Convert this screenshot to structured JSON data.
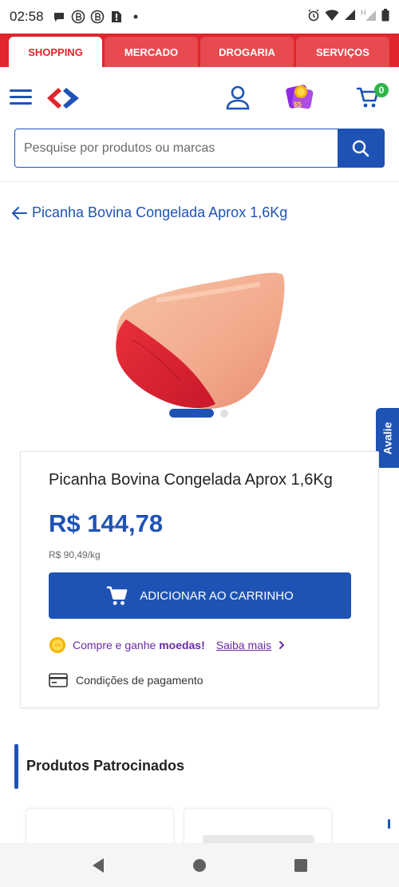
{
  "status_bar": {
    "time": "02:58"
  },
  "tabs": [
    {
      "label": "SHOPPING",
      "active": true
    },
    {
      "label": "MERCADO",
      "active": false
    },
    {
      "label": "DROGARIA",
      "active": false
    },
    {
      "label": "SERVIÇOS",
      "active": false
    }
  ],
  "header": {
    "cart_count": "0"
  },
  "search": {
    "placeholder": "Pesquise por produtos ou marcas"
  },
  "breadcrumb": {
    "back_label": "Picanha Bovina Congelada Aprox 1,6Kg"
  },
  "side_tab": {
    "label": "Avalie"
  },
  "product": {
    "name": "Picanha Bovina Congelada Aprox 1,6Kg",
    "price": "R$ 144,78",
    "unit_price": "R$ 90,49/kg",
    "add_to_cart_label": "ADICIONAR AO CARRINHO",
    "coins_text_prefix": "Compre e ganhe",
    "coins_text_bold": "moedas!",
    "coins_link": "Saiba mais",
    "payment_label": "Condições de pagamento"
  },
  "sponsored": {
    "title": "Produtos Patrocinados"
  },
  "colors": {
    "brand_red": "#e0262c",
    "brand_blue": "#1e53b5",
    "coins_purple": "#6a2aa3",
    "badge_green": "#2fb548"
  }
}
